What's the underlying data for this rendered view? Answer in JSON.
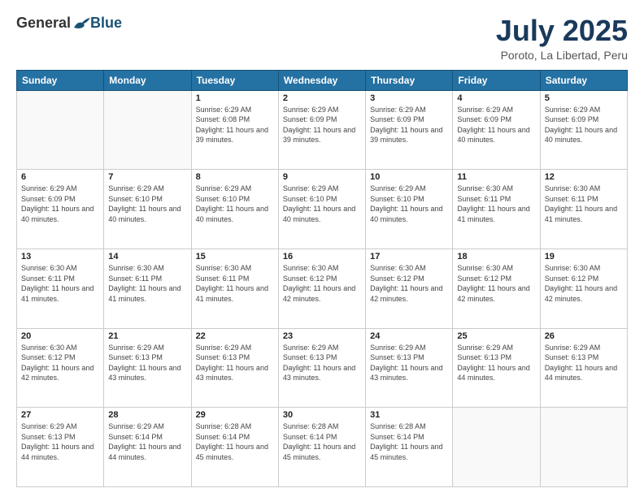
{
  "header": {
    "logo_general": "General",
    "logo_blue": "Blue",
    "month_year": "July 2025",
    "location": "Poroto, La Libertad, Peru"
  },
  "weekdays": [
    "Sunday",
    "Monday",
    "Tuesday",
    "Wednesday",
    "Thursday",
    "Friday",
    "Saturday"
  ],
  "weeks": [
    [
      {
        "day": "",
        "info": ""
      },
      {
        "day": "",
        "info": ""
      },
      {
        "day": "1",
        "info": "Sunrise: 6:29 AM\nSunset: 6:08 PM\nDaylight: 11 hours and 39 minutes."
      },
      {
        "day": "2",
        "info": "Sunrise: 6:29 AM\nSunset: 6:09 PM\nDaylight: 11 hours and 39 minutes."
      },
      {
        "day": "3",
        "info": "Sunrise: 6:29 AM\nSunset: 6:09 PM\nDaylight: 11 hours and 39 minutes."
      },
      {
        "day": "4",
        "info": "Sunrise: 6:29 AM\nSunset: 6:09 PM\nDaylight: 11 hours and 40 minutes."
      },
      {
        "day": "5",
        "info": "Sunrise: 6:29 AM\nSunset: 6:09 PM\nDaylight: 11 hours and 40 minutes."
      }
    ],
    [
      {
        "day": "6",
        "info": "Sunrise: 6:29 AM\nSunset: 6:09 PM\nDaylight: 11 hours and 40 minutes."
      },
      {
        "day": "7",
        "info": "Sunrise: 6:29 AM\nSunset: 6:10 PM\nDaylight: 11 hours and 40 minutes."
      },
      {
        "day": "8",
        "info": "Sunrise: 6:29 AM\nSunset: 6:10 PM\nDaylight: 11 hours and 40 minutes."
      },
      {
        "day": "9",
        "info": "Sunrise: 6:29 AM\nSunset: 6:10 PM\nDaylight: 11 hours and 40 minutes."
      },
      {
        "day": "10",
        "info": "Sunrise: 6:29 AM\nSunset: 6:10 PM\nDaylight: 11 hours and 40 minutes."
      },
      {
        "day": "11",
        "info": "Sunrise: 6:30 AM\nSunset: 6:11 PM\nDaylight: 11 hours and 41 minutes."
      },
      {
        "day": "12",
        "info": "Sunrise: 6:30 AM\nSunset: 6:11 PM\nDaylight: 11 hours and 41 minutes."
      }
    ],
    [
      {
        "day": "13",
        "info": "Sunrise: 6:30 AM\nSunset: 6:11 PM\nDaylight: 11 hours and 41 minutes."
      },
      {
        "day": "14",
        "info": "Sunrise: 6:30 AM\nSunset: 6:11 PM\nDaylight: 11 hours and 41 minutes."
      },
      {
        "day": "15",
        "info": "Sunrise: 6:30 AM\nSunset: 6:11 PM\nDaylight: 11 hours and 41 minutes."
      },
      {
        "day": "16",
        "info": "Sunrise: 6:30 AM\nSunset: 6:12 PM\nDaylight: 11 hours and 42 minutes."
      },
      {
        "day": "17",
        "info": "Sunrise: 6:30 AM\nSunset: 6:12 PM\nDaylight: 11 hours and 42 minutes."
      },
      {
        "day": "18",
        "info": "Sunrise: 6:30 AM\nSunset: 6:12 PM\nDaylight: 11 hours and 42 minutes."
      },
      {
        "day": "19",
        "info": "Sunrise: 6:30 AM\nSunset: 6:12 PM\nDaylight: 11 hours and 42 minutes."
      }
    ],
    [
      {
        "day": "20",
        "info": "Sunrise: 6:30 AM\nSunset: 6:12 PM\nDaylight: 11 hours and 42 minutes."
      },
      {
        "day": "21",
        "info": "Sunrise: 6:29 AM\nSunset: 6:13 PM\nDaylight: 11 hours and 43 minutes."
      },
      {
        "day": "22",
        "info": "Sunrise: 6:29 AM\nSunset: 6:13 PM\nDaylight: 11 hours and 43 minutes."
      },
      {
        "day": "23",
        "info": "Sunrise: 6:29 AM\nSunset: 6:13 PM\nDaylight: 11 hours and 43 minutes."
      },
      {
        "day": "24",
        "info": "Sunrise: 6:29 AM\nSunset: 6:13 PM\nDaylight: 11 hours and 43 minutes."
      },
      {
        "day": "25",
        "info": "Sunrise: 6:29 AM\nSunset: 6:13 PM\nDaylight: 11 hours and 44 minutes."
      },
      {
        "day": "26",
        "info": "Sunrise: 6:29 AM\nSunset: 6:13 PM\nDaylight: 11 hours and 44 minutes."
      }
    ],
    [
      {
        "day": "27",
        "info": "Sunrise: 6:29 AM\nSunset: 6:13 PM\nDaylight: 11 hours and 44 minutes."
      },
      {
        "day": "28",
        "info": "Sunrise: 6:29 AM\nSunset: 6:14 PM\nDaylight: 11 hours and 44 minutes."
      },
      {
        "day": "29",
        "info": "Sunrise: 6:28 AM\nSunset: 6:14 PM\nDaylight: 11 hours and 45 minutes."
      },
      {
        "day": "30",
        "info": "Sunrise: 6:28 AM\nSunset: 6:14 PM\nDaylight: 11 hours and 45 minutes."
      },
      {
        "day": "31",
        "info": "Sunrise: 6:28 AM\nSunset: 6:14 PM\nDaylight: 11 hours and 45 minutes."
      },
      {
        "day": "",
        "info": ""
      },
      {
        "day": "",
        "info": ""
      }
    ]
  ]
}
